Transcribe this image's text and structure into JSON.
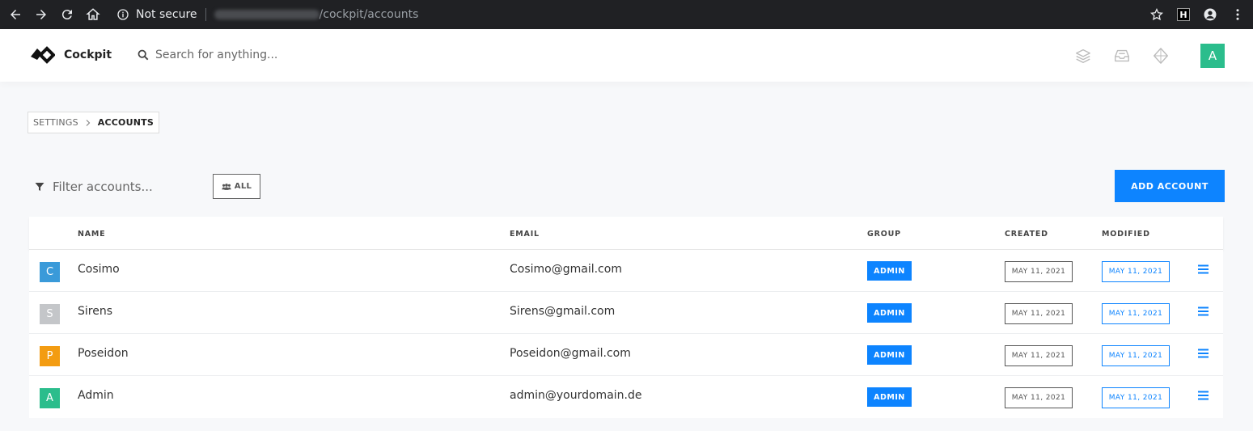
{
  "browser": {
    "security_label": "Not secure",
    "url_path": "/cockpit/accounts"
  },
  "header": {
    "brand": "Cockpit",
    "search_placeholder": "Search for anything...",
    "user_initial": "A",
    "user_color": "#2bbd8c"
  },
  "breadcrumb": {
    "items": [
      "SETTINGS",
      "ACCOUNTS"
    ]
  },
  "toolbar": {
    "filter_placeholder": "Filter accounts...",
    "all_label": "ALL",
    "add_label": "ADD ACCOUNT"
  },
  "table": {
    "columns": [
      "NAME",
      "EMAIL",
      "GROUP",
      "CREATED",
      "MODIFIED"
    ],
    "rows": [
      {
        "initial": "C",
        "color": "#3a9ad9",
        "name": "Cosimo",
        "email": "Cosimo@gmail.com",
        "group": "ADMIN",
        "created": "MAY 11, 2021",
        "modified": "MAY 11, 2021"
      },
      {
        "initial": "S",
        "color": "#c4c6c9",
        "name": "Sirens",
        "email": "Sirens@gmail.com",
        "group": "ADMIN",
        "created": "MAY 11, 2021",
        "modified": "MAY 11, 2021"
      },
      {
        "initial": "P",
        "color": "#f39c12",
        "name": "Poseidon",
        "email": "Poseidon@gmail.com",
        "group": "ADMIN",
        "created": "MAY 11, 2021",
        "modified": "MAY 11, 2021"
      },
      {
        "initial": "A",
        "color": "#2bbd8c",
        "name": "Admin",
        "email": "admin@yourdomain.de",
        "group": "ADMIN",
        "created": "MAY 11, 2021",
        "modified": "MAY 11, 2021"
      }
    ]
  },
  "colors": {
    "accent": "#0d84ff"
  }
}
